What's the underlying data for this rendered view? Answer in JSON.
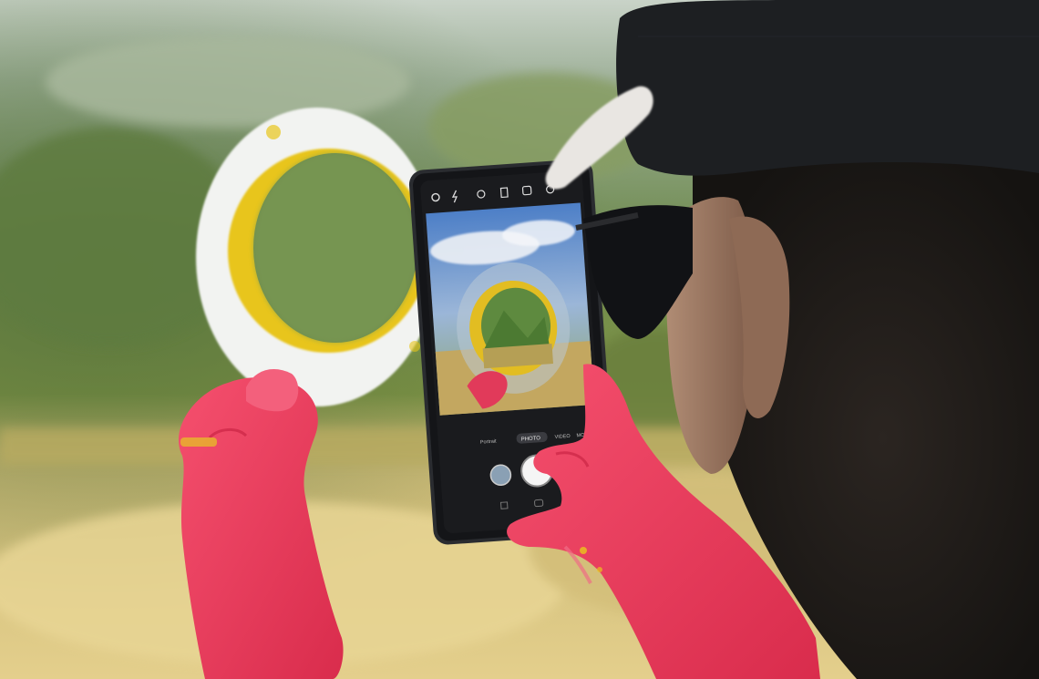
{
  "scene": {
    "kind": "photograph",
    "subject": "hiker photographing landscape through painted paper ring with smartphone camera"
  },
  "camera_app": {
    "modes": [
      "Portrait",
      "PHOTO",
      "VIDEO",
      "MORE"
    ],
    "selected_mode": "PHOTO",
    "icons": [
      "settings-icon",
      "flash-off-icon",
      "timer-icon",
      "aspect-ratio-icon",
      "motion-photo-icon",
      "filter-icon"
    ]
  },
  "colors": {
    "sky_haze": "#cfd6cc",
    "forest": "#6f8a4c",
    "meadow": "#d9c17a",
    "ring_white": "#f2f3f1",
    "ring_yellow": "#e8c51b",
    "glove_pink": "#ef3a5c",
    "phone_body": "#2a2c30",
    "cap": "#1d1f22"
  }
}
